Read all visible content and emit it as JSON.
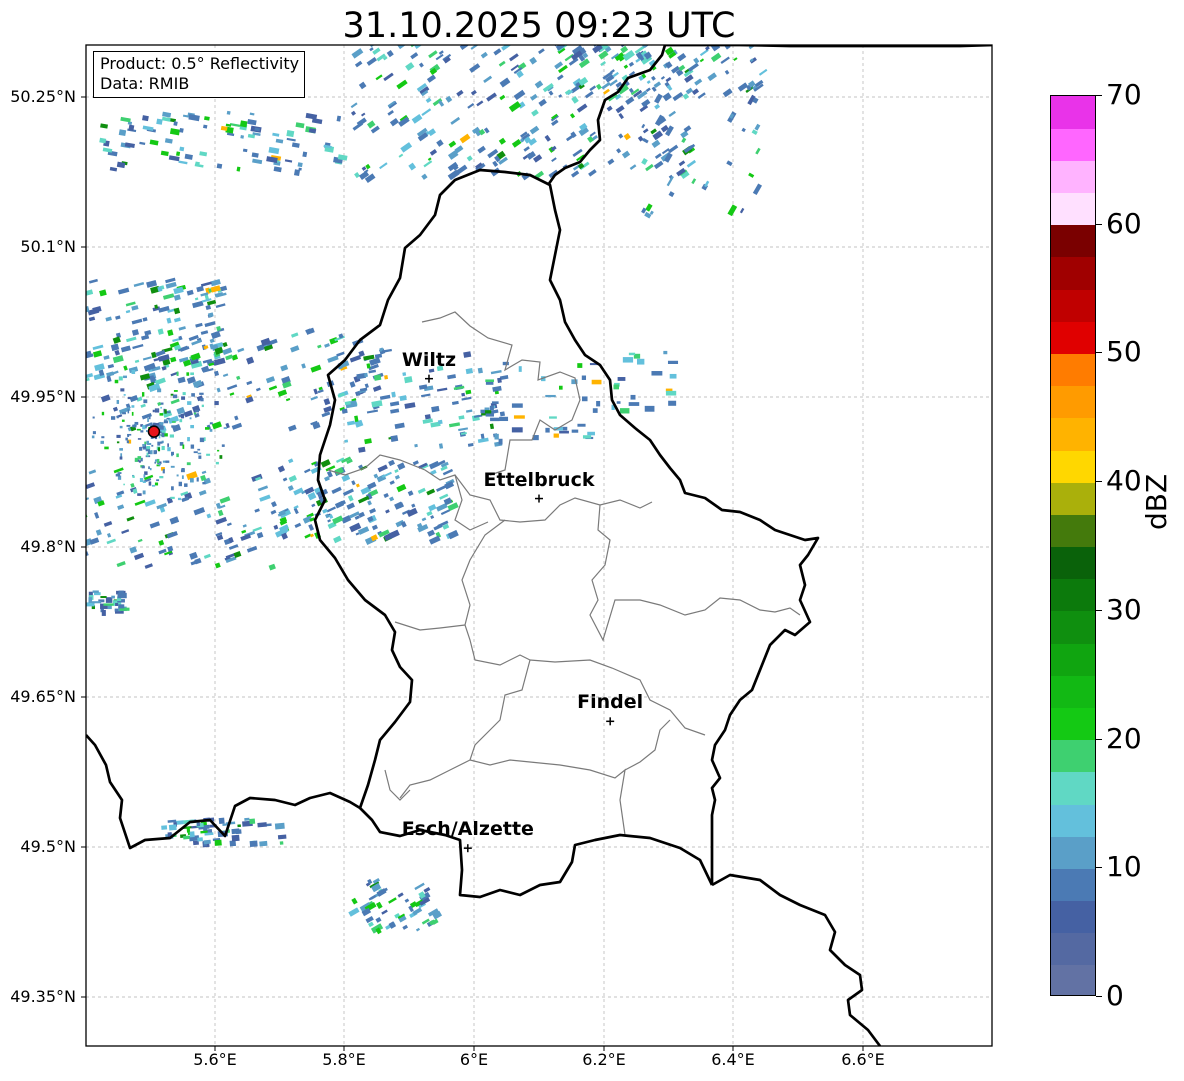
{
  "title": "31.10.2025 09:23 UTC",
  "info": {
    "product": "Product: 0.5° Reflectivity",
    "source": "Data: RMIB"
  },
  "lat_ticks": [
    "50.25°N",
    "50.1°N",
    "49.95°N",
    "49.8°N",
    "49.65°N",
    "49.5°N",
    "49.35°N"
  ],
  "lon_ticks": [
    "5.6°E",
    "5.8°E",
    "6°E",
    "6.2°E",
    "6.4°E",
    "6.6°E"
  ],
  "cities": [
    {
      "name": "Wiltz",
      "lon": 5.93,
      "lat": 49.968
    },
    {
      "name": "Ettelbruck",
      "lon": 6.1,
      "lat": 49.848
    },
    {
      "name": "Findel",
      "lon": 6.21,
      "lat": 49.625
    },
    {
      "name": "Esch/Alzette",
      "lon": 5.99,
      "lat": 49.498
    }
  ],
  "radar_site": {
    "lon": 5.505,
    "lat": 49.915,
    "color": "#e8141a"
  },
  "colorbar": {
    "label": "dBZ",
    "ticks": [
      "0",
      "10",
      "20",
      "30",
      "40",
      "50",
      "60",
      "70"
    ],
    "range": [
      0,
      70
    ],
    "colors": [
      "#6272a4",
      "#5469a2",
      "#4561a3",
      "#4b7ab4",
      "#5a9fc8",
      "#63c0dc",
      "#60d8c4",
      "#3ed070",
      "#14c914",
      "#12b914",
      "#10a510",
      "#0f8f0f",
      "#0c7a0c",
      "#0a620a",
      "#447a0c",
      "#aab00b",
      "#ffd700",
      "#ffb300",
      "#ff9b00",
      "#ff7c00",
      "#e00000",
      "#c00000",
      "#a00000",
      "#7a0000",
      "#ffe0ff",
      "#ffb3ff",
      "#ff66ff",
      "#e933e9"
    ]
  }
}
